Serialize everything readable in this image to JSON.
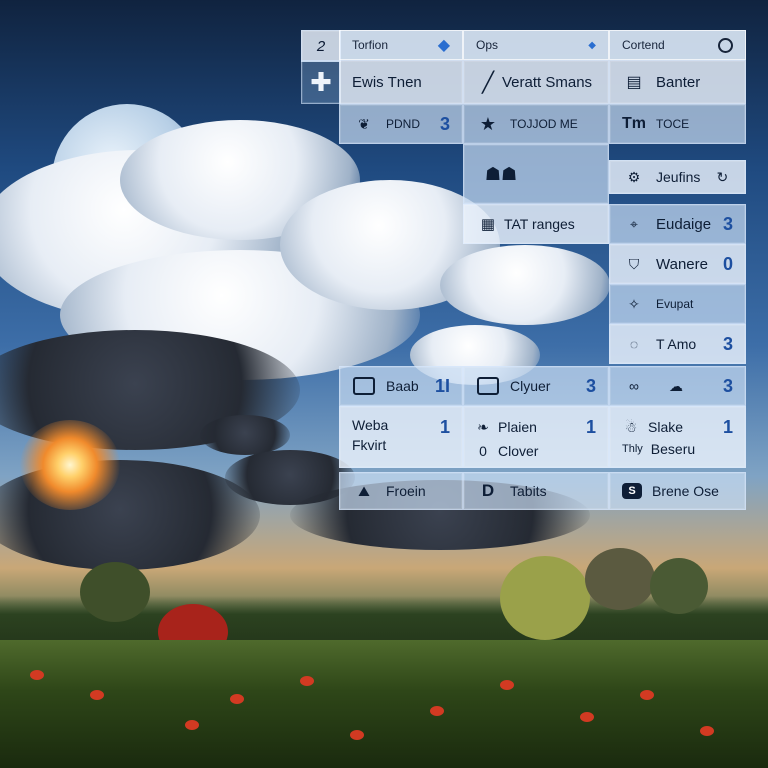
{
  "columns": [
    {
      "header": "Torfion",
      "header_icon": "diamond-icon"
    },
    {
      "header": "Ops",
      "header_icon": "small-diamond-icon"
    },
    {
      "header": "Cortend",
      "header_icon": "circle-icon"
    }
  ],
  "left_tab": {
    "number": "2",
    "icon": "plus-icon"
  },
  "col1": [
    {
      "label": "Ewis Tnen",
      "icon": "",
      "number": ""
    },
    {
      "label": "PDND",
      "icon": "swirl-icon",
      "number": "3"
    }
  ],
  "col2": [
    {
      "label": "Veratt Smans",
      "icon": "slash-icon",
      "number": ""
    },
    {
      "label": "TOJJOD ME",
      "icon": "star-icon",
      "number": ""
    },
    {
      "label": "",
      "icon": "figures-icon",
      "number": ""
    },
    {
      "label": "TAT ranges",
      "icon": "grid-icon",
      "number": ""
    }
  ],
  "col3": [
    {
      "label": "Banter",
      "icon": "bars-icon",
      "number": ""
    },
    {
      "label": "TOCE",
      "icon": "tm-icon",
      "number": ""
    },
    {
      "label": "Jeufins",
      "icon": "gear-icon",
      "number": "",
      "extra_icon": "refresh-icon"
    },
    {
      "label": "Eudaige",
      "icon": "crosshair-icon",
      "number": "3"
    },
    {
      "label": "Wanere",
      "icon": "bucket-icon",
      "number": "0"
    },
    {
      "label": "Evupat",
      "icon": "sparkle-icon",
      "number": ""
    },
    {
      "label": "T Amo",
      "icon": "ring-icon",
      "number": "3"
    }
  ],
  "lower": {
    "row1": [
      {
        "label": "Baab",
        "icon": "box-icon",
        "number": "1I"
      },
      {
        "label": "Clyuer",
        "icon": "box-icon",
        "number": "3"
      },
      {
        "label": "",
        "icon": "cloud-icon",
        "number": "3",
        "lead_icon": "link-icon"
      }
    ],
    "row2": [
      {
        "label": "Weba",
        "sublabel": "Fkvirt",
        "number": "1"
      },
      {
        "label": "Plaien",
        "sublabel": "Clover",
        "icon": "leaf-icon",
        "subicon": "oval-icon",
        "number": "1"
      },
      {
        "label": "Slake",
        "sublabel": "Beseru",
        "prefix": "Thly",
        "icon": "mascot-icon",
        "number": "1"
      }
    ],
    "row3": [
      {
        "label": "Froein",
        "icon": "mountain-icon"
      },
      {
        "label": "Tabits",
        "icon": "d-icon"
      },
      {
        "label": "Brene Ose",
        "icon": "s-badge-icon"
      }
    ]
  }
}
